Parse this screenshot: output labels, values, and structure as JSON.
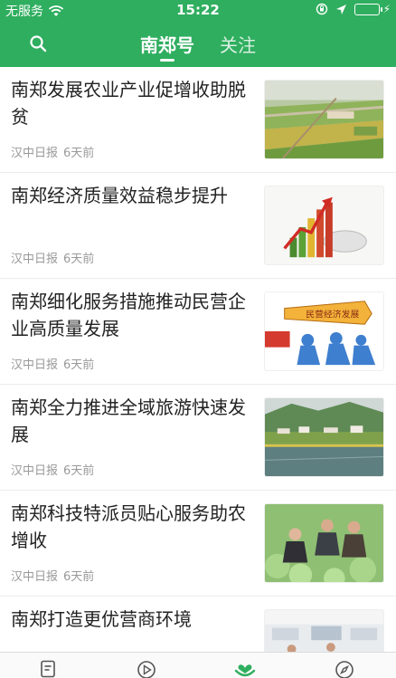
{
  "status_bar": {
    "carrier": "无服务",
    "time": "15:22"
  },
  "nav": {
    "tabs": [
      {
        "label": "南郑号",
        "active": true
      },
      {
        "label": "关注",
        "active": false
      }
    ],
    "accent_color": "#2fae5f"
  },
  "feed": {
    "items": [
      {
        "title": "南郑发展农业产业促增收助脱贫",
        "source": "汉中日报",
        "time": "6天前",
        "image": "farmland-aerial-photo"
      },
      {
        "title": "南郑经济质量效益稳步提升",
        "source": "汉中日报",
        "time": "6天前",
        "image": "growth-bar-chart-illustration"
      },
      {
        "title": "南郑细化服务措施推动民营企业高质量发展",
        "source": "汉中日报",
        "time": "6天前",
        "image": "private-economy-development-illustration",
        "image_text": "民营经济发展"
      },
      {
        "title": "南郑全力推进全域旅游快速发展",
        "source": "汉中日报",
        "time": "6天前",
        "image": "lake-village-photo"
      },
      {
        "title": "南郑科技特派员贴心服务助农增收",
        "source": "汉中日报",
        "time": "6天前",
        "image": "cabbage-field-farmers-photo"
      },
      {
        "title": "南郑打造更优营商环境",
        "source": "",
        "time": "",
        "image": "service-hall-photo"
      }
    ]
  },
  "tab_bar": {
    "items": [
      {
        "icon": "document-icon"
      },
      {
        "icon": "play-icon"
      },
      {
        "icon": "heart-hands-icon",
        "active": true
      },
      {
        "icon": "compass-icon"
      }
    ]
  }
}
